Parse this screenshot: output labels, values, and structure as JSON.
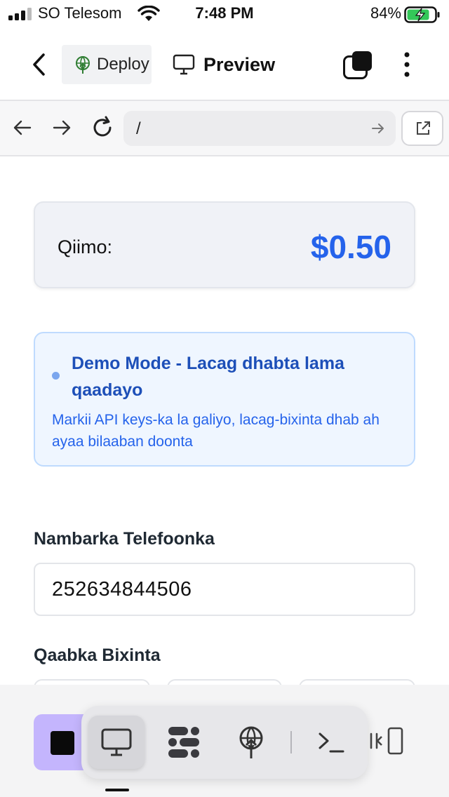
{
  "status_bar": {
    "carrier": "SO Telesom",
    "time": "7:48 PM",
    "battery": "84%"
  },
  "toolbar": {
    "deploy_label": "Deploy",
    "preview_label": "Preview"
  },
  "address_bar": {
    "url": "/"
  },
  "content": {
    "price_label": "Qiimo:",
    "price_value": "$0.50",
    "demo": {
      "title": "Demo Mode - Lacag dhabta lama qaadayo",
      "body": "Markii API keys-ka la galiyo, lacag-bixinta dhab ah ayaa bilaaban doonta"
    },
    "phone_label": "Nambarka Telefoonka",
    "phone_value": "252634844506",
    "method_label": "Qaabka Bixinta"
  },
  "colors": {
    "accent": "#2563eb",
    "stop_button": "#c4b5fd"
  }
}
